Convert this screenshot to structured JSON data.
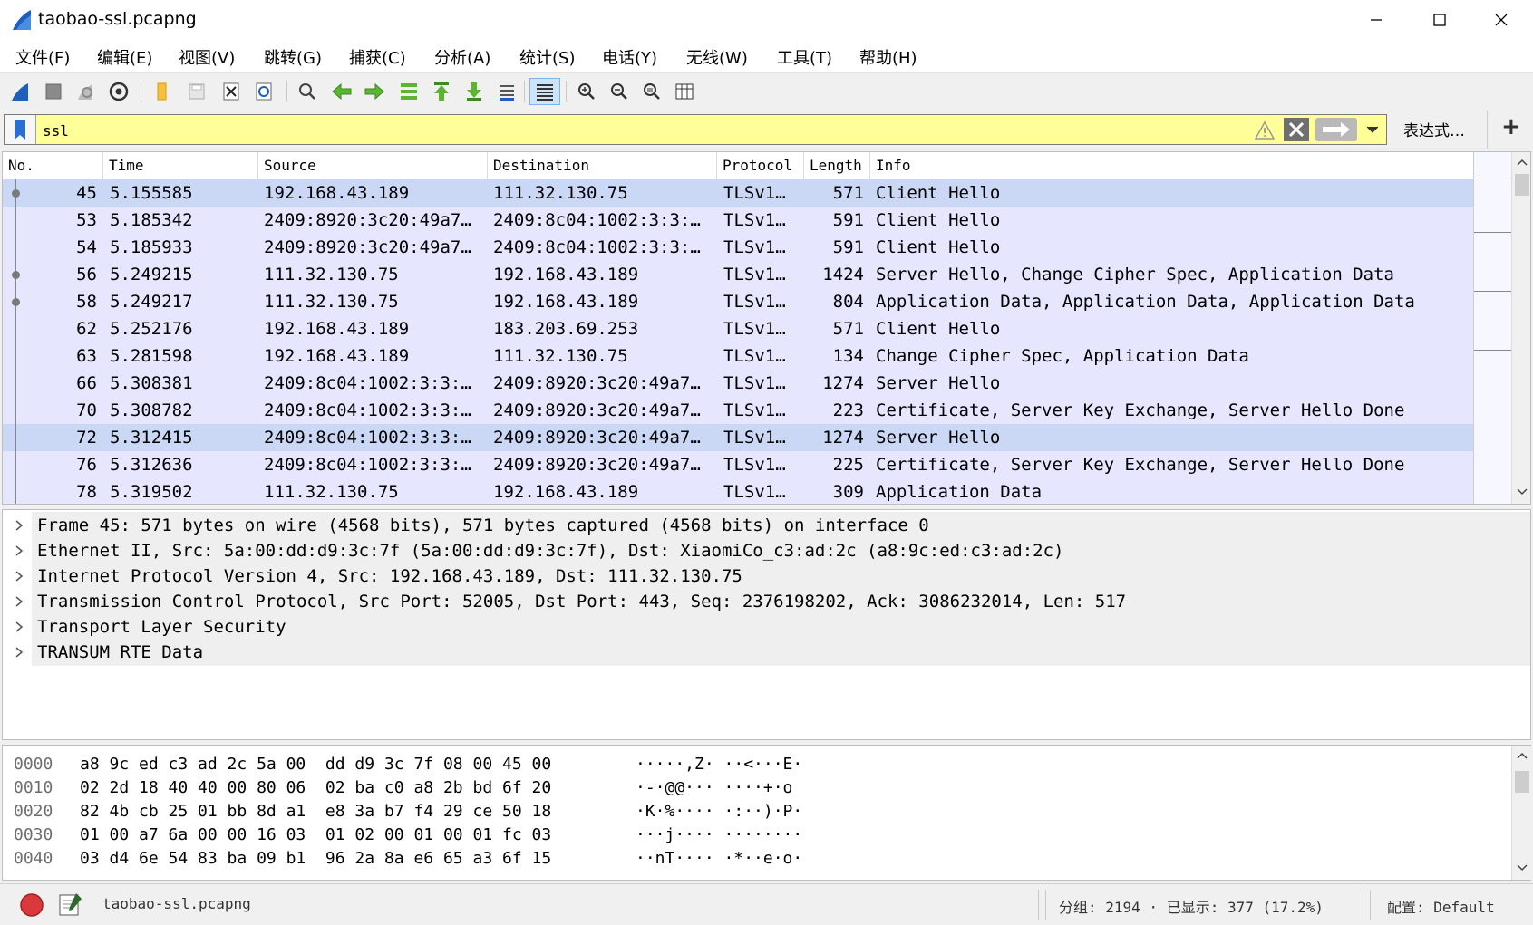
{
  "window": {
    "title": "taobao-ssl.pcapng",
    "minimize_glyph": "—",
    "maximize_glyph": "☐",
    "close_glyph": "✕"
  },
  "menu": [
    {
      "label": "文件(F)"
    },
    {
      "label": "编辑(E)"
    },
    {
      "label": "视图(V)"
    },
    {
      "label": "跳转(G)"
    },
    {
      "label": "捕获(C)"
    },
    {
      "label": "分析(A)"
    },
    {
      "label": "统计(S)"
    },
    {
      "label": "电话(Y)"
    },
    {
      "label": "无线(W)"
    },
    {
      "label": "工具(T)"
    },
    {
      "label": "帮助(H)"
    }
  ],
  "toolbar": {
    "icons": [
      "shark-fin-start-icon",
      "stop-capture-icon",
      "restart-capture-icon",
      "capture-options-icon",
      "open-file-icon",
      "save-file-icon",
      "close-file-icon",
      "reload-file-icon",
      "find-packet-icon",
      "go-back-icon",
      "go-forward-icon",
      "go-to-packet-icon",
      "go-first-icon",
      "go-last-icon",
      "auto-scroll-icon",
      "colorize-icon",
      "zoom-in-icon",
      "zoom-out-icon",
      "zoom-normal-icon",
      "resize-columns-icon"
    ]
  },
  "filter": {
    "value": "ssl",
    "expression_label": "表达式…",
    "add_label": "+"
  },
  "packet_list": {
    "columns": [
      "No.",
      "Time",
      "Source",
      "Destination",
      "Protocol",
      "Length",
      "Info"
    ],
    "rows": [
      {
        "no": "45",
        "time": "5.155585",
        "src": "192.168.43.189",
        "dst": "111.32.130.75",
        "proto": "TLSv1…",
        "len": "571",
        "info": "Client Hello",
        "selected": true,
        "mark": "dot"
      },
      {
        "no": "53",
        "time": "5.185342",
        "src": "2409:8920:3c20:49a7…",
        "dst": "2409:8c04:1002:3:3:…",
        "proto": "TLSv1…",
        "len": "591",
        "info": "Client Hello",
        "mark": "line"
      },
      {
        "no": "54",
        "time": "5.185933",
        "src": "2409:8920:3c20:49a7…",
        "dst": "2409:8c04:1002:3:3:…",
        "proto": "TLSv1…",
        "len": "591",
        "info": "Client Hello",
        "mark": "line"
      },
      {
        "no": "56",
        "time": "5.249215",
        "src": "111.32.130.75",
        "dst": "192.168.43.189",
        "proto": "TLSv1…",
        "len": "1424",
        "info": "Server Hello, Change Cipher Spec, Application Data",
        "mark": "dot"
      },
      {
        "no": "58",
        "time": "5.249217",
        "src": "111.32.130.75",
        "dst": "192.168.43.189",
        "proto": "TLSv1…",
        "len": "804",
        "info": "Application Data, Application Data, Application Data",
        "mark": "dot"
      },
      {
        "no": "62",
        "time": "5.252176",
        "src": "192.168.43.189",
        "dst": "183.203.69.253",
        "proto": "TLSv1…",
        "len": "571",
        "info": "Client Hello",
        "mark": "line"
      },
      {
        "no": "63",
        "time": "5.281598",
        "src": "192.168.43.189",
        "dst": "111.32.130.75",
        "proto": "TLSv1…",
        "len": "134",
        "info": "Change Cipher Spec, Application Data",
        "mark": "line"
      },
      {
        "no": "66",
        "time": "5.308381",
        "src": "2409:8c04:1002:3:3:…",
        "dst": "2409:8920:3c20:49a7…",
        "proto": "TLSv1…",
        "len": "1274",
        "info": "Server Hello",
        "mark": "line"
      },
      {
        "no": "70",
        "time": "5.308782",
        "src": "2409:8c04:1002:3:3:…",
        "dst": "2409:8920:3c20:49a7…",
        "proto": "TLSv1…",
        "len": "223",
        "info": "Certificate, Server Key Exchange, Server Hello Done",
        "mark": "line"
      },
      {
        "no": "72",
        "time": "5.312415",
        "src": "2409:8c04:1002:3:3:…",
        "dst": "2409:8920:3c20:49a7…",
        "proto": "TLSv1…",
        "len": "1274",
        "info": "Server Hello",
        "hover": true,
        "mark": "line"
      },
      {
        "no": "76",
        "time": "5.312636",
        "src": "2409:8c04:1002:3:3:…",
        "dst": "2409:8920:3c20:49a7…",
        "proto": "TLSv1…",
        "len": "225",
        "info": "Certificate, Server Key Exchange, Server Hello Done",
        "mark": "line"
      },
      {
        "no": "78",
        "time": "5.319502",
        "src": "111.32.130.75",
        "dst": "192.168.43.189",
        "proto": "TLSv1…",
        "len": "309",
        "info": "Application Data",
        "mark": "line"
      }
    ]
  },
  "details": [
    "Frame 45: 571 bytes on wire (4568 bits), 571 bytes captured (4568 bits) on interface 0",
    "Ethernet II, Src: 5a:00:dd:d9:3c:7f (5a:00:dd:d9:3c:7f), Dst: XiaomiCo_c3:ad:2c (a8:9c:ed:c3:ad:2c)",
    "Internet Protocol Version 4, Src: 192.168.43.189, Dst: 111.32.130.75",
    "Transmission Control Protocol, Src Port: 52005, Dst Port: 443, Seq: 2376198202, Ack: 3086232014, Len: 517",
    "Transport Layer Security",
    "TRANSUM RTE Data"
  ],
  "bytes": [
    {
      "offset": "0000",
      "hex": "a8 9c ed c3 ad 2c 5a 00  dd d9 3c 7f 08 00 45 00",
      "ascii": "·····,Z· ··<···E·"
    },
    {
      "offset": "0010",
      "hex": "02 2d 18 40 40 00 80 06  02 ba c0 a8 2b bd 6f 20",
      "ascii": "·-·@@··· ····+·o "
    },
    {
      "offset": "0020",
      "hex": "82 4b cb 25 01 bb 8d a1  e8 3a b7 f4 29 ce 50 18",
      "ascii": "·K·%···· ·:··)·P·"
    },
    {
      "offset": "0030",
      "hex": "01 00 a7 6a 00 00 16 03  01 02 00 01 00 01 fc 03",
      "ascii": "···j···· ········"
    },
    {
      "offset": "0040",
      "hex": "03 d4 6e 54 83 ba 09 b1  96 2a 8a e6 65 a3 6f 15",
      "ascii": "··nT···· ·*··e·o·"
    }
  ],
  "status": {
    "file": "taobao-ssl.pcapng",
    "packets": "分组: 2194 · 已显示: 377 (17.2%)",
    "profile": "配置: Default"
  },
  "colors": {
    "row_bg": "#e7e6ff",
    "row_selected": "#cad8f5",
    "filter_bg": "#ffff99",
    "accent": "#1c5fbf"
  }
}
